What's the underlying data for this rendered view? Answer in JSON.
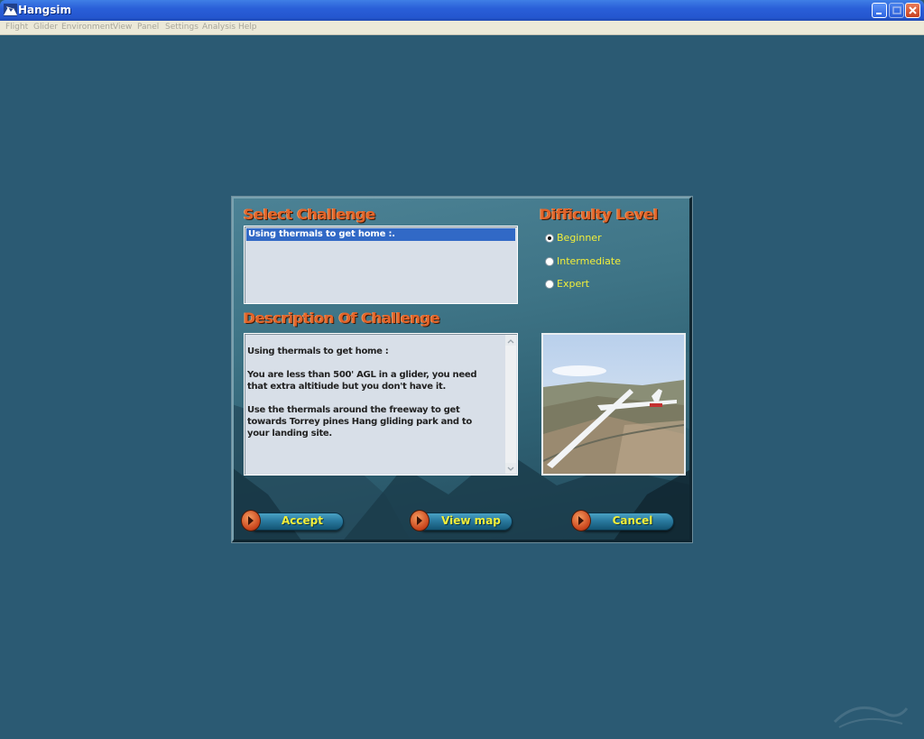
{
  "window": {
    "title": "Hangsim",
    "menu": [
      "Flight",
      "Glider",
      "Environment",
      "View",
      "Panel",
      "Settings",
      "Analysis",
      "Help"
    ]
  },
  "dialog": {
    "select_heading": "Select Challenge",
    "challenges": [
      "Using thermals to get home :."
    ],
    "selected_challenge": "Using thermals to get home :.",
    "difficulty_heading": "Difficulty Level",
    "difficulty_options": [
      "Beginner",
      "Intermediate",
      "Expert"
    ],
    "selected_difficulty": "Beginner",
    "description_heading": "Description Of Challenge",
    "description": "Using thermals to get home :\n\nYou are less than 500' AGL in a glider, you need\nthat extra altitiude but you don't have it.\n\nUse the thermals around the freeway to get\ntowards Torrey pines Hang gliding park and to\nyour landing site.",
    "buttons": {
      "accept": "Accept",
      "view_map": "View map",
      "cancel": "Cancel"
    }
  },
  "colors": {
    "desktop": "#2b5a73",
    "heading": "#e2642a",
    "label_yellow": "#f2ee3a",
    "selection": "#3169c6"
  },
  "icons": [
    "app-icon",
    "minimize-icon",
    "maximize-icon",
    "close-icon",
    "radio-icon",
    "arrow-cap-icon",
    "glider-preview"
  ]
}
